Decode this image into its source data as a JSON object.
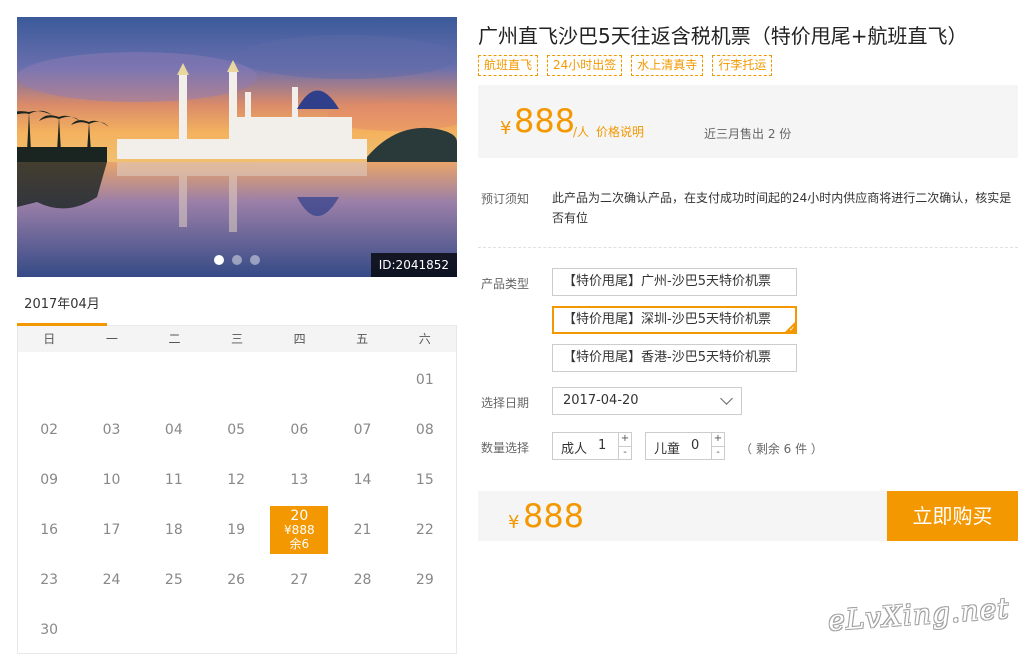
{
  "photo": {
    "id_label": "ID:2041852",
    "dots": 3,
    "active_dot": 0
  },
  "calendar": {
    "month_tab": "2017年04月",
    "weekdays": [
      "日",
      "一",
      "二",
      "三",
      "四",
      "五",
      "六"
    ],
    "leading_blanks": 6,
    "days": [
      "01",
      "02",
      "03",
      "04",
      "05",
      "06",
      "07",
      "08",
      "09",
      "10",
      "11",
      "12",
      "13",
      "14",
      "15",
      "16",
      "17",
      "18",
      "19",
      "20",
      "21",
      "22",
      "23",
      "24",
      "25",
      "26",
      "27",
      "28",
      "29",
      "30"
    ],
    "selected_day": {
      "day": "20",
      "price": "¥888",
      "stock": "余6"
    }
  },
  "product": {
    "title": "广州直飞沙巴5天往返含税机票（特价甩尾+航班直飞）",
    "tags": [
      "航班直飞",
      "24小时出签",
      "水上清真寺",
      "行李托运"
    ]
  },
  "price": {
    "currency": "¥",
    "amount": "888",
    "unit": "/人",
    "explain_link": "价格说明",
    "sold": "近三月售出 2 份"
  },
  "notice": {
    "label": "预订须知",
    "text": "此产品为二次确认产品，在支付成功时间起的24小时内供应商将进行二次确认，核实是否有位"
  },
  "product_type": {
    "label": "产品类型",
    "options": [
      "【特价甩尾】广州-沙巴5天特价机票",
      "【特价甩尾】深圳-沙巴5天特价机票",
      "【特价甩尾】香港-沙巴5天特价机票"
    ],
    "selected_index": 1
  },
  "date": {
    "label": "选择日期",
    "value": "2017-04-20"
  },
  "quantity": {
    "label": "数量选择",
    "adult_label": "成人",
    "adult_value": "1",
    "child_label": "儿童",
    "child_value": "0",
    "plus": "+",
    "minus": "-",
    "remaining": "（ 剩余 6 件 ）"
  },
  "total": {
    "currency": "¥",
    "amount": "888",
    "buy_label": "立即购买"
  },
  "watermark": "eLvXing.net",
  "colors": {
    "accent": "#f39800",
    "panel_bg": "#f5f5f5"
  }
}
